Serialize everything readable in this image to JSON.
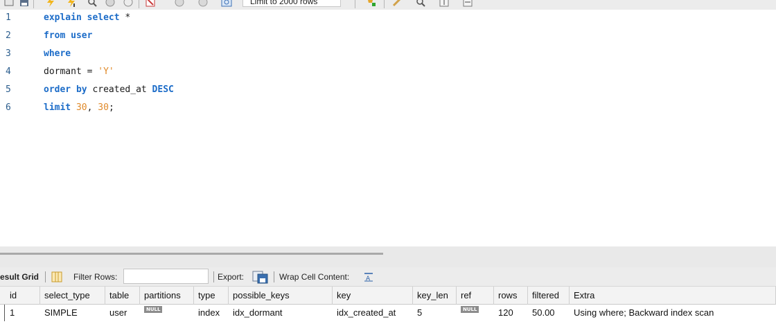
{
  "toolbar": {
    "limit_label": "Limit to 2000 rows",
    "icons": [
      "new-tab-icon",
      "save-icon",
      "lightning-icon",
      "lightning-cursor-icon",
      "magnifier-icon",
      "stop-icon",
      "toggle-icon",
      "cancel-icon",
      "commit-icon",
      "refresh-icon",
      "beautify-icon",
      "brush-icon",
      "search-icon",
      "invisible-chars-icon",
      "wrap-icon"
    ]
  },
  "editor": {
    "lines": [
      {
        "num": "1",
        "tokens": [
          {
            "t": "explain select",
            "c": "kw"
          },
          {
            "t": " *",
            "c": "ident"
          }
        ]
      },
      {
        "num": "2",
        "tokens": [
          {
            "t": "from user",
            "c": "kw"
          }
        ]
      },
      {
        "num": "3",
        "tokens": [
          {
            "t": "where",
            "c": "kw"
          }
        ]
      },
      {
        "num": "4",
        "tokens": [
          {
            "t": "dormant = ",
            "c": "ident"
          },
          {
            "t": "'Y'",
            "c": "str"
          }
        ]
      },
      {
        "num": "5",
        "tokens": [
          {
            "t": "order by",
            "c": "kw"
          },
          {
            "t": " created_at ",
            "c": "ident"
          },
          {
            "t": "DESC",
            "c": "kw"
          }
        ]
      },
      {
        "num": "6",
        "tokens": [
          {
            "t": "limit",
            "c": "kw"
          },
          {
            "t": " ",
            "c": "ident"
          },
          {
            "t": "30",
            "c": "num"
          },
          {
            "t": ", ",
            "c": "ident"
          },
          {
            "t": "30",
            "c": "num"
          },
          {
            "t": ";",
            "c": "ident"
          }
        ]
      }
    ]
  },
  "result_bar": {
    "result_grid_label": "esult Grid",
    "filter_label": "Filter Rows:",
    "filter_value": "",
    "export_label": "Export:",
    "wrap_label": "Wrap Cell Content:"
  },
  "grid": {
    "columns": [
      "id",
      "select_type",
      "table",
      "partitions",
      "type",
      "possible_keys",
      "key",
      "key_len",
      "ref",
      "rows",
      "filtered",
      "Extra"
    ],
    "rows": [
      {
        "id": "1",
        "select_type": "SIMPLE",
        "table": "user",
        "partitions": "NULL",
        "type": "index",
        "possible_keys": "idx_dormant",
        "key": "idx_created_at",
        "key_len": "5",
        "ref": "NULL",
        "rows": "120",
        "filtered": "50.00",
        "Extra": "Using where; Backward index scan"
      }
    ]
  },
  "colors": {
    "keyword": "#1c6cc8",
    "string": "#e08a2a",
    "line_number": "#2c5e8e"
  }
}
